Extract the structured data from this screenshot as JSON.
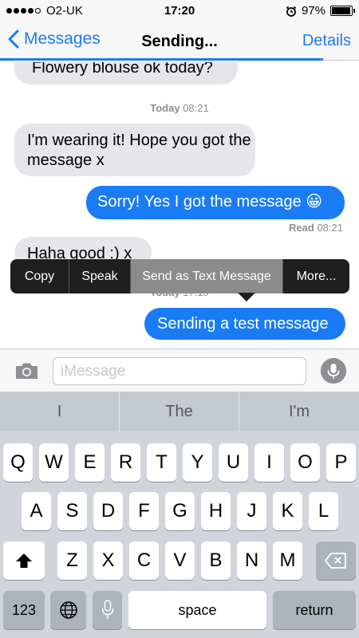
{
  "status_bar": {
    "signal_dots": [
      true,
      true,
      true,
      true,
      false
    ],
    "carrier": "O2-UK",
    "time": "17:20",
    "alarm_icon": "alarm-clock-icon",
    "battery": "97%",
    "battery_level": 0.97
  },
  "nav": {
    "back_label": "Messages",
    "title": "Sending...",
    "details_label": "Details",
    "send_progress": 0.9
  },
  "conversation": {
    "messages": [
      {
        "direction": "incoming",
        "text": "Flowery blouse ok today?"
      },
      {
        "direction": "incoming",
        "text": "I'm wearing it! Hope you got the message x"
      },
      {
        "direction": "outgoing",
        "text": "Sorry! Yes I got the message 😀"
      },
      {
        "direction": "incoming",
        "text": "Haha good :) x"
      },
      {
        "direction": "outgoing",
        "text": "Sending a test message"
      }
    ],
    "timestamps": [
      {
        "day": "Today",
        "time": "08:21"
      },
      {
        "day": "Today",
        "time": "17:19"
      }
    ],
    "read_receipt": {
      "label": "Read",
      "time": "08:21"
    }
  },
  "context_menu": {
    "items": [
      "Copy",
      "Speak",
      "Send as Text Message",
      "More..."
    ],
    "highlighted": "Send as Text Message"
  },
  "input": {
    "placeholder": "iMessage",
    "value": "",
    "camera_icon": "camera-icon",
    "mic_icon": "microphone-icon"
  },
  "keyboard": {
    "predictions": [
      "I",
      "The",
      "I'm"
    ],
    "row1": [
      "Q",
      "W",
      "E",
      "R",
      "T",
      "Y",
      "U",
      "I",
      "O",
      "P"
    ],
    "row2": [
      "A",
      "S",
      "D",
      "F",
      "G",
      "H",
      "J",
      "K",
      "L"
    ],
    "row3": [
      "Z",
      "X",
      "C",
      "V",
      "B",
      "N",
      "M"
    ],
    "shift_icon": "shift-arrow-icon",
    "delete_icon": "backspace-icon",
    "numbers_label": "123",
    "globe_icon": "globe-icon",
    "dictation_icon": "microphone-icon",
    "space_label": "space",
    "return_label": "return"
  }
}
